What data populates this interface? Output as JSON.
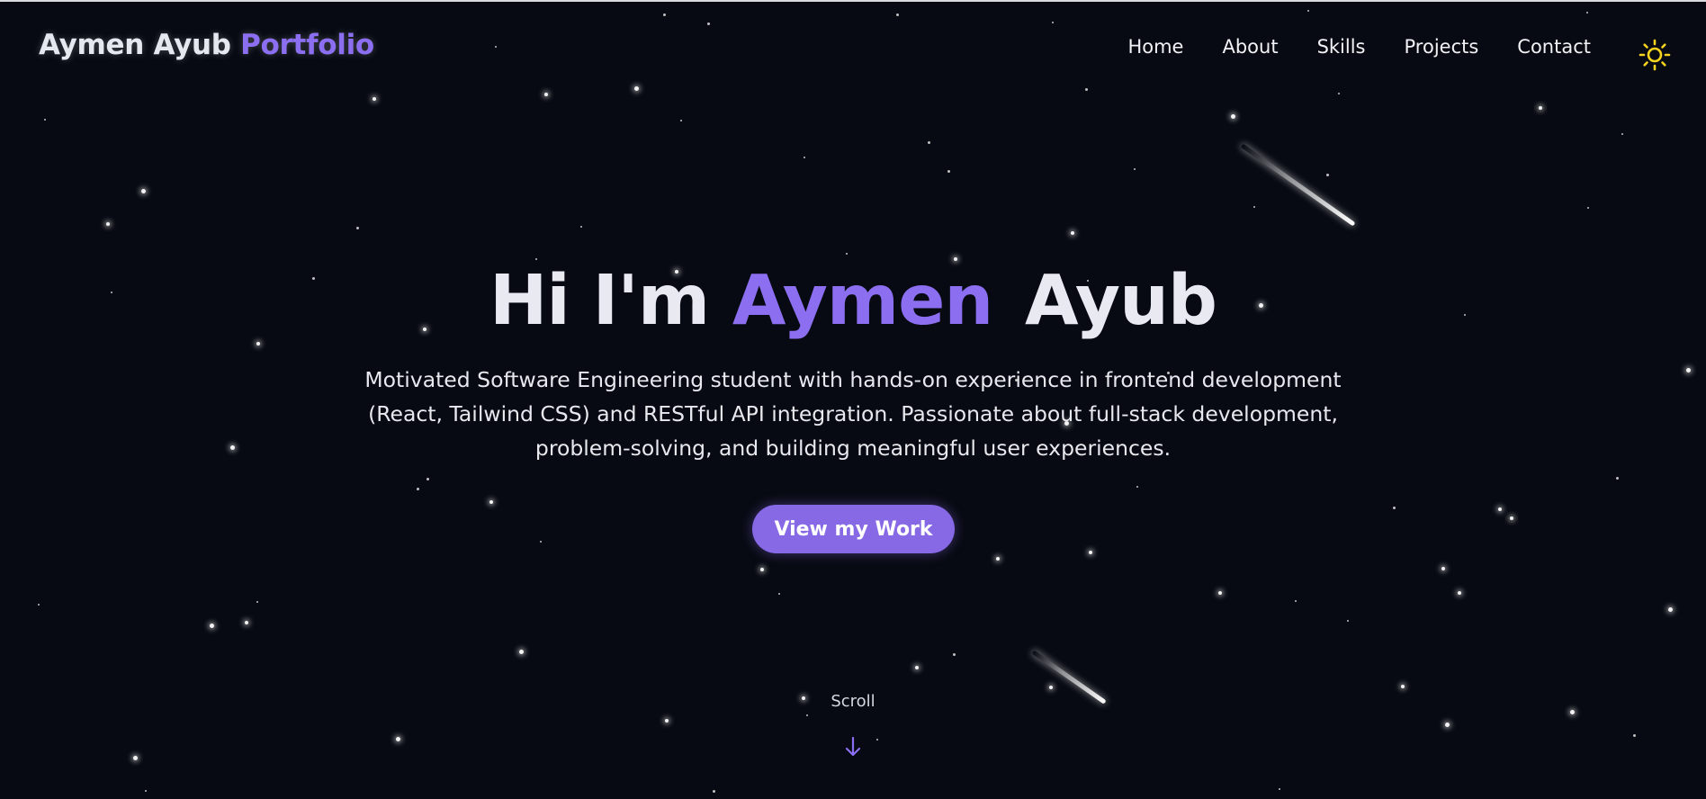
{
  "header": {
    "brand_name": "Aymen Ayub",
    "brand_accent": "Portfolio",
    "nav": [
      "Home",
      "About",
      "Skills",
      "Projects",
      "Contact"
    ],
    "theme_toggle_icon": "sun-icon"
  },
  "hero": {
    "greeting": "Hi I'm",
    "first_name": "Aymen",
    "last_name": "Ayub",
    "description": "Motivated Software Engineering student with hands-on experience in frontend development (React, Tailwind CSS) and RESTful API integration. Passionate about full-stack development, problem-solving, and building meaningful user experiences.",
    "cta_label": "View my Work"
  },
  "scroll": {
    "label": "Scroll",
    "icon": "arrow-down-icon"
  },
  "colors": {
    "background": "#070a12",
    "accent": "#8b6ff0",
    "button": "#8769e6",
    "sun": "#f6d31e"
  }
}
